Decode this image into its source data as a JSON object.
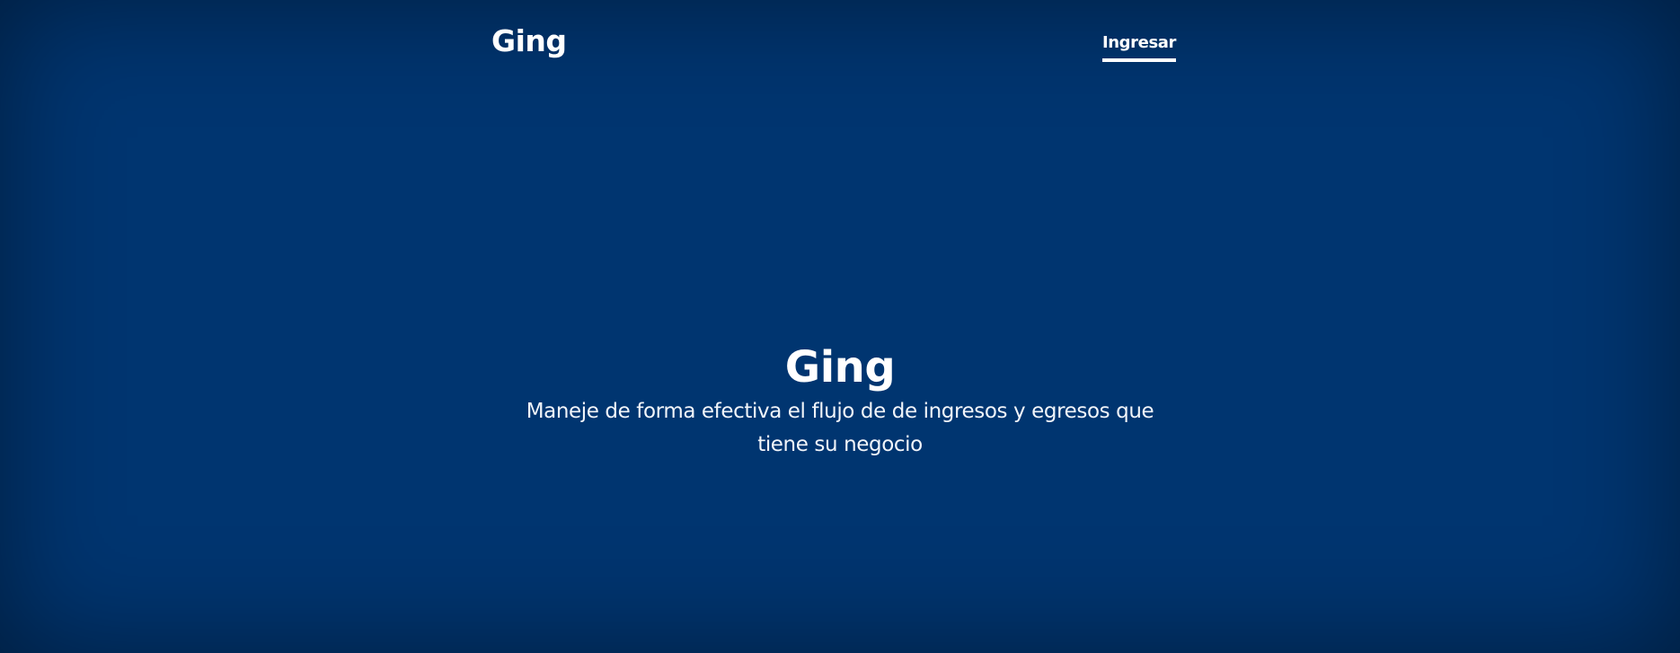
{
  "colors": {
    "background": "#003570",
    "text": "#ffffff"
  },
  "header": {
    "brand": "Ging",
    "nav": {
      "login_label": "Ingresar"
    }
  },
  "cover": {
    "heading": "Ging",
    "lead": "Maneje de forma efectiva el flujo de de ingresos y egresos que tiene su negocio"
  }
}
